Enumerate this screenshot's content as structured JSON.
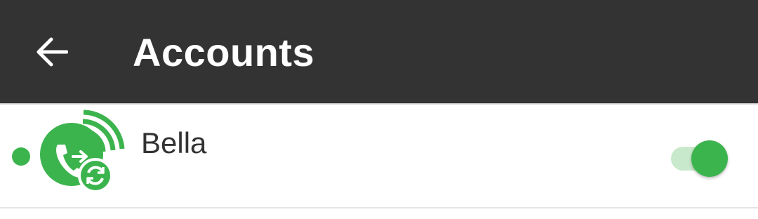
{
  "app_bar": {
    "title": "Accounts",
    "back_icon": "arrow-left-icon",
    "background": "#333333"
  },
  "accounts": [
    {
      "name": "Bella",
      "status": "online",
      "status_color": "#3cb44e",
      "icon": "sip-phone-sync-icon",
      "enabled": true
    }
  ],
  "colors": {
    "accent": "#3cb44e",
    "toggle_track_on": "#c8e9cb",
    "title_text": "#ffffff",
    "body_text": "#333333"
  }
}
